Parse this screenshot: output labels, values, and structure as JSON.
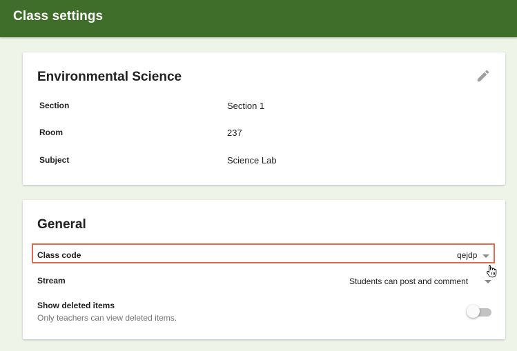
{
  "header": {
    "title": "Class settings"
  },
  "class_details": {
    "name": "Environmental Science",
    "edit_icon": "pencil-icon",
    "rows": [
      {
        "label": "Section",
        "value": "Section 1"
      },
      {
        "label": "Room",
        "value": "237"
      },
      {
        "label": "Subject",
        "value": "Science Lab"
      }
    ]
  },
  "general": {
    "title": "General",
    "class_code": {
      "label": "Class code",
      "value": "qejdp"
    },
    "stream": {
      "label": "Stream",
      "value": "Students can post and comment"
    },
    "show_deleted": {
      "label": "Show deleted items",
      "description": "Only teachers can view deleted items.",
      "enabled": false
    }
  },
  "colors": {
    "header_bg": "#3e6e2a",
    "page_bg": "#eef4e8",
    "highlight": "#e8664a"
  }
}
